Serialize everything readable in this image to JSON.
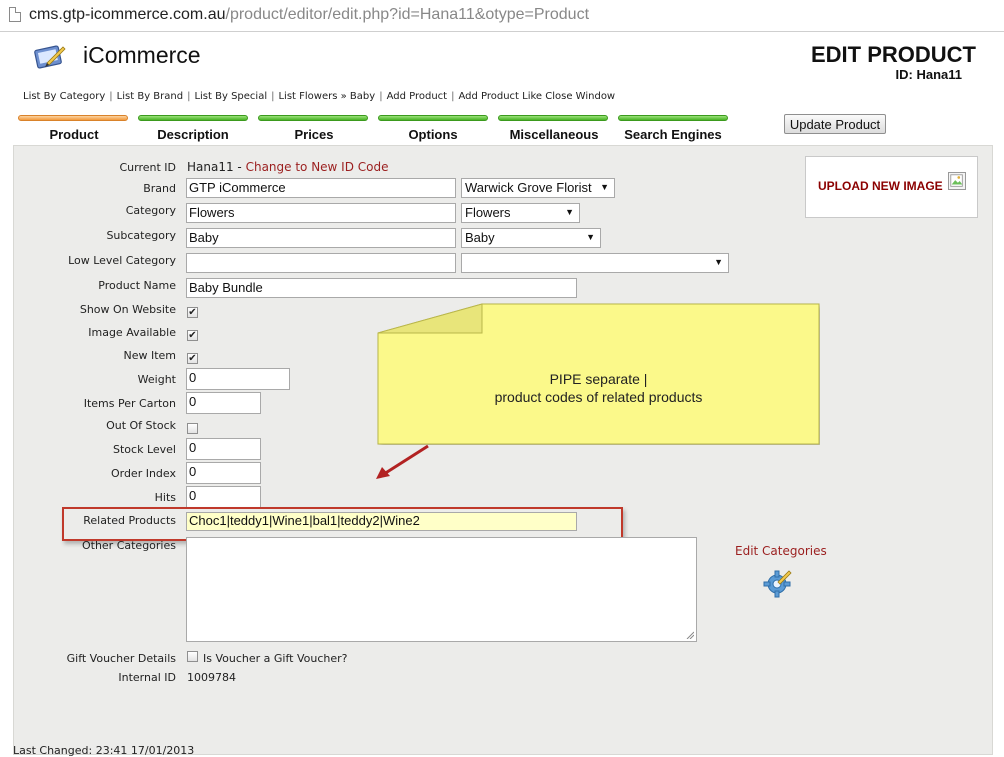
{
  "browser": {
    "url_host": "cms.gtp-icommerce.com.au",
    "url_path": "/product/editor/edit.php?id=Hana11&otype=Product"
  },
  "header": {
    "app_title": "iCommerce",
    "page_title": "EDIT PRODUCT",
    "page_id": "ID: Hana11"
  },
  "quick_links": [
    "List By Category",
    "List By Brand",
    "List By Special",
    "List Flowers » Baby",
    "Add Product",
    "Add Product Like",
    "Close Window"
  ],
  "tabs": [
    {
      "label": "Product",
      "active": true
    },
    {
      "label": "Description",
      "active": false
    },
    {
      "label": "Prices",
      "active": false
    },
    {
      "label": "Options",
      "active": false
    },
    {
      "label": "Miscellaneous",
      "active": false
    },
    {
      "label": "Search Engines",
      "active": false
    }
  ],
  "update_button": "Update Product",
  "upload": {
    "label": "UPLOAD NEW IMAGE"
  },
  "form": {
    "current_id": {
      "label": "Current ID",
      "value": "Hana11",
      "link_sep": " - ",
      "link": "Change to New ID Code"
    },
    "brand": {
      "label": "Brand",
      "value": "GTP iCommerce",
      "select": "Warwick Grove Florist"
    },
    "category": {
      "label": "Category",
      "value": "Flowers",
      "select": "Flowers"
    },
    "subcategory": {
      "label": "Subcategory",
      "value": "Baby",
      "select": "Baby"
    },
    "low_level_category": {
      "label": "Low Level Category",
      "value": "",
      "select": ""
    },
    "product_name": {
      "label": "Product Name",
      "value": "Baby Bundle"
    },
    "show_on_website": {
      "label": "Show On Website",
      "checked": true
    },
    "image_available": {
      "label": "Image Available",
      "checked": true
    },
    "new_item": {
      "label": "New Item",
      "checked": true
    },
    "weight": {
      "label": "Weight",
      "value": "0"
    },
    "items_per_carton": {
      "label": "Items Per Carton",
      "value": "0"
    },
    "out_of_stock": {
      "label": "Out Of Stock",
      "checked": false
    },
    "stock_level": {
      "label": "Stock Level",
      "value": "0"
    },
    "order_index": {
      "label": "Order Index",
      "value": "0"
    },
    "hits": {
      "label": "Hits",
      "value": "0"
    },
    "related_products": {
      "label": "Related Products",
      "value": "Choc1|teddy1|Wine1|bal1|teddy2|Wine2"
    },
    "other_categories": {
      "label": "Other Categories",
      "value": ""
    },
    "gift_voucher": {
      "label": "Gift Voucher Details",
      "checkbox_label": "Is Voucher a Gift Voucher?",
      "checked": false
    },
    "internal_id": {
      "label": "Internal ID",
      "value": "1009784"
    }
  },
  "edit_categories": "Edit Categories",
  "callout": {
    "line1": "PIPE separate |",
    "line2": "product codes of related products"
  },
  "footer": {
    "last_changed": "Last Changed: 23:41 17/01/2013"
  },
  "colors": {
    "link": "#9b1f1f",
    "callout_fill": "#fbf98a",
    "highlight": "#c0392b",
    "tab_active": "#f39a3c",
    "tab_inactive": "#4ab325"
  },
  "icons": [
    "page-icon",
    "logo-icon",
    "broken-image-icon",
    "gear-icon",
    "arrow-icon",
    "resize-icon"
  ]
}
